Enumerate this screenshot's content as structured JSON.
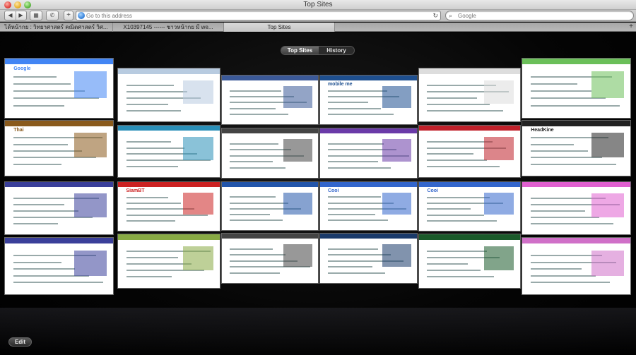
{
  "window": {
    "title": "Top Sites"
  },
  "toolbar": {
    "back_icon": "◀",
    "forward_icon": "▶",
    "topsites_icon": "▦",
    "bookmarks_icon": "✆",
    "add_icon": "+",
    "address_placeholder": "Go to this address",
    "reload_icon": "↻",
    "search_placeholder": "Google",
    "search_icon": "⌕"
  },
  "tabs": [
    {
      "label": "ได้หน้ากย : วิทยาศาสตร์ คณิตศาสตร์ วิศ..."
    },
    {
      "label": "X10397145 ------ ชาวหน้ากย มี we..."
    },
    {
      "label": "Top Sites"
    }
  ],
  "new_tab_icon": "+",
  "segmented": {
    "top_sites": "Top Sites",
    "history": "History"
  },
  "edit_label": "Edit",
  "thumbnails": [
    {
      "label": "Google",
      "accent": "#4285f4"
    },
    {
      "label": "",
      "accent": "#b8cbe0"
    },
    {
      "label": "",
      "accent": "#3b5998"
    },
    {
      "label": "mobile me",
      "accent": "#1e4f8f"
    },
    {
      "label": "",
      "accent": "#dddddd"
    },
    {
      "label": "",
      "accent": "#6bbf59"
    },
    {
      "label": "Thai",
      "accent": "#8a5a1c"
    },
    {
      "label": "",
      "accent": "#2a8fb8"
    },
    {
      "label": "",
      "accent": "#444444"
    },
    {
      "label": "",
      "accent": "#6a3aa8"
    },
    {
      "label": "",
      "accent": "#c0202a"
    },
    {
      "label": "HeadKine",
      "accent": "#222222"
    },
    {
      "label": "",
      "accent": "#3a3f9a"
    },
    {
      "label": "SiamBT",
      "accent": "#cc2222"
    },
    {
      "label": "",
      "accent": "#2255aa"
    },
    {
      "label": "Cooi",
      "accent": "#3366cc"
    },
    {
      "label": "Cooi",
      "accent": "#3366cc"
    },
    {
      "label": "",
      "accent": "#e060d0"
    },
    {
      "label": "",
      "accent": "#3a3f9a"
    },
    {
      "label": "",
      "accent": "#88aa44"
    },
    {
      "label": "",
      "accent": "#444444"
    },
    {
      "label": "",
      "accent": "#1a3a6a"
    },
    {
      "label": "",
      "accent": "#1a5a2a"
    },
    {
      "label": "",
      "accent": "#d070c8"
    }
  ]
}
